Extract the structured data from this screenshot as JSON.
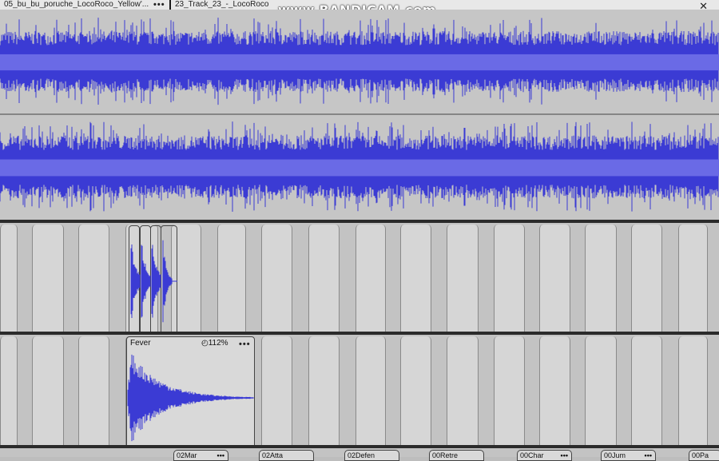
{
  "watermark": "www.BANDICAM.com",
  "track1": {
    "clip1_name": "05_bu_bu_poruche_LocoRoco_Yellow'...",
    "clip2_name": "23_Track_23_-_LocoRoco",
    "menu": "•••"
  },
  "fever_clip": {
    "name": "Fever",
    "speed": "112%",
    "menu": "•••"
  },
  "close_label": "✕",
  "bottom_tabs": [
    {
      "label": "02Mar",
      "menu": "•••"
    },
    {
      "label": "02Atta",
      "menu": ""
    },
    {
      "label": "02Defen",
      "menu": ""
    },
    {
      "label": "00Retre",
      "menu": ""
    },
    {
      "label": "00Char",
      "menu": "•••"
    },
    {
      "label": "00Jum",
      "menu": "•••"
    },
    {
      "label": "00Pa",
      "menu": ""
    }
  ],
  "colors": {
    "waveform": "#3b3bd4",
    "waveform_light": "#6a6ae6",
    "lane_bg": "#c3c3c3",
    "stripe": "#d6d6d6"
  }
}
